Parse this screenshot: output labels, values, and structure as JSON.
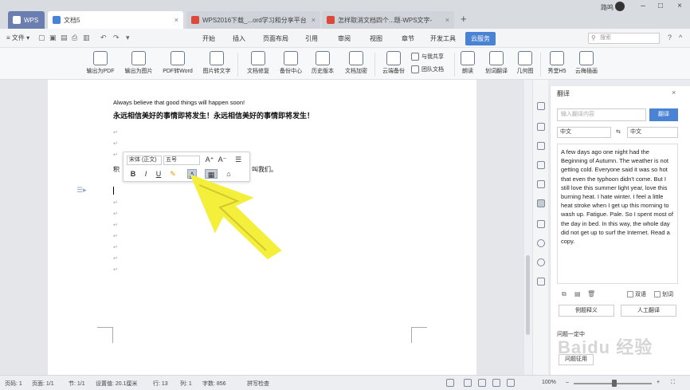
{
  "tabs": [
    {
      "label": "WPS"
    },
    {
      "label": "文档5"
    },
    {
      "label": "WPS2016下载_...ord学习和分享平台"
    },
    {
      "label": "怎样取消文档四个...题-WPS文字-"
    }
  ],
  "title_bar": {
    "user_name": "路鸣"
  },
  "menu": {
    "file": "文件",
    "items": [
      "开始",
      "插入",
      "页面布局",
      "引用",
      "审阅",
      "视图",
      "章节",
      "开发工具",
      "云服务"
    ],
    "active": "云服务",
    "search_placeholder": "搜索"
  },
  "ribbon": {
    "buttons": [
      "输出为PDF",
      "输出为图片",
      "PDF转Word",
      "图片转文字",
      "文档修复",
      "备份中心",
      "历史版本",
      "文档加密",
      "云端备份",
      "朗读",
      "划词翻译",
      "几何图",
      "秀堂H5",
      "云梅插画"
    ],
    "small_buttons": [
      "与我共享",
      "团队文档"
    ]
  },
  "document": {
    "line_en": "Always believe that good things will happen soon!",
    "line_cn": "永远相信美好的事情即将发生！永远相信美好的事情即将发生！",
    "selected_line_prefix": "积",
    "selected_line_suffix": "期，叫我们。"
  },
  "format_toolbar": {
    "font": "宋体 (正文)",
    "size": "五号",
    "buttons": [
      "B",
      "I",
      "U",
      "A",
      "A"
    ]
  },
  "translate_panel": {
    "title": "翻译",
    "input_placeholder": "输入翻译内容",
    "translate_button": "翻译",
    "source_lang": "中文",
    "swap": "⇆",
    "target_lang": "中文",
    "result": "A few days ago one night had the Beginning of Autumn. The weather is not getting cold. Everyone said it was so hot that even the typhoon didn't come. But I still love this summer light year, love this burning heat. I hate winter. I feel a little heat stroke when I get up this morning to wash up. Fatigue. Pale. So I spent most of the day in bed. In this way, the whole day did not get up to surf the Internet. Read a copy.",
    "option1": "双语",
    "option2": "划词",
    "btn_left": "例题释义",
    "btn_right": "人工翻译",
    "promo": "问题一定中",
    "btn_bottom": "问题征用"
  },
  "watermark": "Baidu 经验",
  "status_bar": {
    "page": "页码: 1",
    "pages": "页面: 1/1",
    "section": "节: 1/1",
    "setting": "设置值: 20.1厘米",
    "row": "行: 13",
    "col": "列: 1",
    "words": "字数: 856",
    "spell": "拼写检查",
    "zoom": "100%"
  }
}
